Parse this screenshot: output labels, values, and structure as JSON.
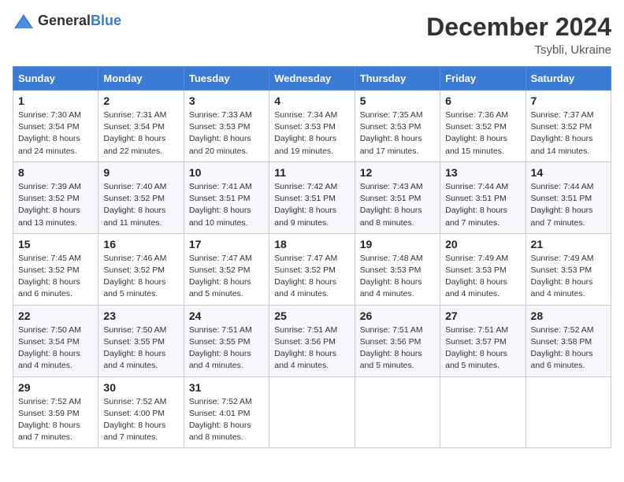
{
  "header": {
    "logo_general": "General",
    "logo_blue": "Blue",
    "month_title": "December 2024",
    "location": "Tsybli, Ukraine"
  },
  "weekdays": [
    "Sunday",
    "Monday",
    "Tuesday",
    "Wednesday",
    "Thursday",
    "Friday",
    "Saturday"
  ],
  "weeks": [
    [
      {
        "day": "1",
        "sunrise": "Sunrise: 7:30 AM",
        "sunset": "Sunset: 3:54 PM",
        "daylight": "Daylight: 8 hours and 24 minutes."
      },
      {
        "day": "2",
        "sunrise": "Sunrise: 7:31 AM",
        "sunset": "Sunset: 3:54 PM",
        "daylight": "Daylight: 8 hours and 22 minutes."
      },
      {
        "day": "3",
        "sunrise": "Sunrise: 7:33 AM",
        "sunset": "Sunset: 3:53 PM",
        "daylight": "Daylight: 8 hours and 20 minutes."
      },
      {
        "day": "4",
        "sunrise": "Sunrise: 7:34 AM",
        "sunset": "Sunset: 3:53 PM",
        "daylight": "Daylight: 8 hours and 19 minutes."
      },
      {
        "day": "5",
        "sunrise": "Sunrise: 7:35 AM",
        "sunset": "Sunset: 3:53 PM",
        "daylight": "Daylight: 8 hours and 17 minutes."
      },
      {
        "day": "6",
        "sunrise": "Sunrise: 7:36 AM",
        "sunset": "Sunset: 3:52 PM",
        "daylight": "Daylight: 8 hours and 15 minutes."
      },
      {
        "day": "7",
        "sunrise": "Sunrise: 7:37 AM",
        "sunset": "Sunset: 3:52 PM",
        "daylight": "Daylight: 8 hours and 14 minutes."
      }
    ],
    [
      {
        "day": "8",
        "sunrise": "Sunrise: 7:39 AM",
        "sunset": "Sunset: 3:52 PM",
        "daylight": "Daylight: 8 hours and 13 minutes."
      },
      {
        "day": "9",
        "sunrise": "Sunrise: 7:40 AM",
        "sunset": "Sunset: 3:52 PM",
        "daylight": "Daylight: 8 hours and 11 minutes."
      },
      {
        "day": "10",
        "sunrise": "Sunrise: 7:41 AM",
        "sunset": "Sunset: 3:51 PM",
        "daylight": "Daylight: 8 hours and 10 minutes."
      },
      {
        "day": "11",
        "sunrise": "Sunrise: 7:42 AM",
        "sunset": "Sunset: 3:51 PM",
        "daylight": "Daylight: 8 hours and 9 minutes."
      },
      {
        "day": "12",
        "sunrise": "Sunrise: 7:43 AM",
        "sunset": "Sunset: 3:51 PM",
        "daylight": "Daylight: 8 hours and 8 minutes."
      },
      {
        "day": "13",
        "sunrise": "Sunrise: 7:44 AM",
        "sunset": "Sunset: 3:51 PM",
        "daylight": "Daylight: 8 hours and 7 minutes."
      },
      {
        "day": "14",
        "sunrise": "Sunrise: 7:44 AM",
        "sunset": "Sunset: 3:51 PM",
        "daylight": "Daylight: 8 hours and 7 minutes."
      }
    ],
    [
      {
        "day": "15",
        "sunrise": "Sunrise: 7:45 AM",
        "sunset": "Sunset: 3:52 PM",
        "daylight": "Daylight: 8 hours and 6 minutes."
      },
      {
        "day": "16",
        "sunrise": "Sunrise: 7:46 AM",
        "sunset": "Sunset: 3:52 PM",
        "daylight": "Daylight: 8 hours and 5 minutes."
      },
      {
        "day": "17",
        "sunrise": "Sunrise: 7:47 AM",
        "sunset": "Sunset: 3:52 PM",
        "daylight": "Daylight: 8 hours and 5 minutes."
      },
      {
        "day": "18",
        "sunrise": "Sunrise: 7:47 AM",
        "sunset": "Sunset: 3:52 PM",
        "daylight": "Daylight: 8 hours and 4 minutes."
      },
      {
        "day": "19",
        "sunrise": "Sunrise: 7:48 AM",
        "sunset": "Sunset: 3:53 PM",
        "daylight": "Daylight: 8 hours and 4 minutes."
      },
      {
        "day": "20",
        "sunrise": "Sunrise: 7:49 AM",
        "sunset": "Sunset: 3:53 PM",
        "daylight": "Daylight: 8 hours and 4 minutes."
      },
      {
        "day": "21",
        "sunrise": "Sunrise: 7:49 AM",
        "sunset": "Sunset: 3:53 PM",
        "daylight": "Daylight: 8 hours and 4 minutes."
      }
    ],
    [
      {
        "day": "22",
        "sunrise": "Sunrise: 7:50 AM",
        "sunset": "Sunset: 3:54 PM",
        "daylight": "Daylight: 8 hours and 4 minutes."
      },
      {
        "day": "23",
        "sunrise": "Sunrise: 7:50 AM",
        "sunset": "Sunset: 3:55 PM",
        "daylight": "Daylight: 8 hours and 4 minutes."
      },
      {
        "day": "24",
        "sunrise": "Sunrise: 7:51 AM",
        "sunset": "Sunset: 3:55 PM",
        "daylight": "Daylight: 8 hours and 4 minutes."
      },
      {
        "day": "25",
        "sunrise": "Sunrise: 7:51 AM",
        "sunset": "Sunset: 3:56 PM",
        "daylight": "Daylight: 8 hours and 4 minutes."
      },
      {
        "day": "26",
        "sunrise": "Sunrise: 7:51 AM",
        "sunset": "Sunset: 3:56 PM",
        "daylight": "Daylight: 8 hours and 5 minutes."
      },
      {
        "day": "27",
        "sunrise": "Sunrise: 7:51 AM",
        "sunset": "Sunset: 3:57 PM",
        "daylight": "Daylight: 8 hours and 5 minutes."
      },
      {
        "day": "28",
        "sunrise": "Sunrise: 7:52 AM",
        "sunset": "Sunset: 3:58 PM",
        "daylight": "Daylight: 8 hours and 6 minutes."
      }
    ],
    [
      {
        "day": "29",
        "sunrise": "Sunrise: 7:52 AM",
        "sunset": "Sunset: 3:59 PM",
        "daylight": "Daylight: 8 hours and 7 minutes."
      },
      {
        "day": "30",
        "sunrise": "Sunrise: 7:52 AM",
        "sunset": "Sunset: 4:00 PM",
        "daylight": "Daylight: 8 hours and 7 minutes."
      },
      {
        "day": "31",
        "sunrise": "Sunrise: 7:52 AM",
        "sunset": "Sunset: 4:01 PM",
        "daylight": "Daylight: 8 hours and 8 minutes."
      },
      null,
      null,
      null,
      null
    ]
  ]
}
